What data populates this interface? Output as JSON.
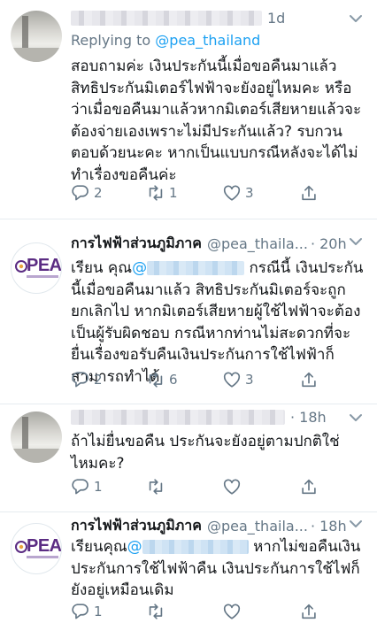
{
  "tweets": [
    {
      "time": "1d",
      "replying_prefix": "Replying to ",
      "replying_handle": "@pea_thailand",
      "text": "สอบถามค่ะ เงินประกันนี้เมื่อขอคืนมาแล้ว สิทธิประกันมิเตอร์ไฟฟ้าจะยังอยู่ไหมคะ หรือว่าเมื่อขอคืนมาแล้วหากมิเตอร์เสียหายแล้วจะต้องจ่ายเองเพราะไม่มีประกันแล้ว? รบกวนตอบด้วยนะคะ หากเป็นแบบกรณีหลังจะได้ไม่ทำเรื่องขอคืนค่ะ",
      "replies": "2",
      "retweets": "1",
      "likes": "3"
    },
    {
      "name": "การไฟฟ้าส่วนภูมิภาค",
      "handle": "@pea_thaila...",
      "time": "· 20h",
      "text_pre": "เรียน คุณ",
      "mention": "@",
      "text_post": " กรณีนี้ เงินประกันนี้เมื่อขอคืนมาแล้ว สิทธิประกันมิเตอร์จะถูกยกเลิกไป หากมิเตอร์เสียหายผู้ใช้ไฟฟ้าจะต้องเป็นผู้รับผิดชอบ กรณีหากท่านไม่สะดวกที่จะยื่นเรื่องขอรับคืนเงินประกันการใช้ไฟฟ้าก็สามารถทำได้",
      "replies": "2",
      "retweets": "6",
      "likes": "3"
    },
    {
      "time": "· 18h",
      "text": "ถ้าไม่ยื่นขอคืน ประกันจะยังอยู่ตามปกติใช่ไหมคะ?",
      "replies": "1",
      "retweets": "",
      "likes": ""
    },
    {
      "name": "การไฟฟ้าส่วนภูมิภาค",
      "handle": "@pea_thaila...",
      "time": "· 18h",
      "text_pre": "เรียนคุณ",
      "mention": "@",
      "text_post": " หากไม่ขอคืนเงินประกันการใช้ไฟฟ้าคืน เงินประกันการใช้ไฟก็ยังอยู่เหมือนเดิม",
      "replies": "1",
      "retweets": "",
      "likes": ""
    }
  ],
  "logo_text": "PEA",
  "colors": {
    "accent": "#1da1f2",
    "text": "#14171a",
    "muted": "#657786",
    "pea_purple": "#5b2c83"
  },
  "icons": [
    "chevron-down-icon",
    "reply-icon",
    "retweet-icon",
    "like-icon",
    "share-icon"
  ]
}
